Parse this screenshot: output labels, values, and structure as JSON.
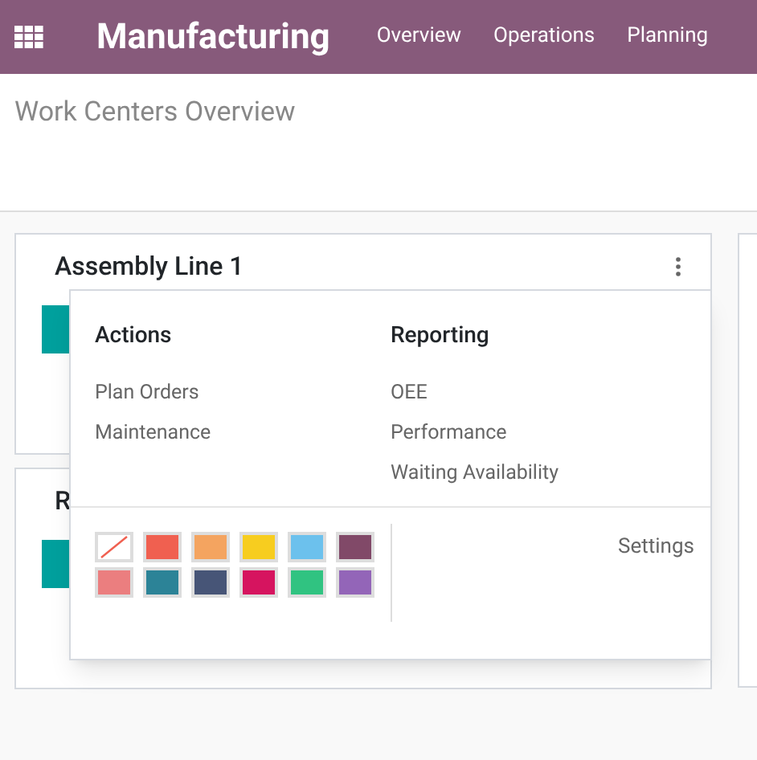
{
  "navbar": {
    "app_title": "Manufacturing",
    "menu": [
      "Overview",
      "Operations",
      "Planning"
    ]
  },
  "breadcrumb": "Work Centers Overview",
  "cards": [
    {
      "title": "Assembly Line 1"
    },
    {
      "title": "R"
    }
  ],
  "dropdown": {
    "sections": [
      {
        "title": "Actions",
        "items": [
          "Plan Orders",
          "Maintenance"
        ]
      },
      {
        "title": "Reporting",
        "items": [
          "OEE",
          "Performance",
          "Waiting Availability"
        ]
      }
    ],
    "colors": [
      {
        "kind": "none"
      },
      {
        "kind": "color",
        "color": "#f06050"
      },
      {
        "kind": "color",
        "color": "#f4a460"
      },
      {
        "kind": "color",
        "color": "#f7cd1f"
      },
      {
        "kind": "color",
        "color": "#6cc1ed"
      },
      {
        "kind": "color",
        "color": "#814968"
      },
      {
        "kind": "color",
        "color": "#eb7e7f"
      },
      {
        "kind": "color",
        "color": "#2c8397"
      },
      {
        "kind": "color",
        "color": "#475577"
      },
      {
        "kind": "color",
        "color": "#d6145f"
      },
      {
        "kind": "color",
        "color": "#30c381"
      },
      {
        "kind": "color",
        "color": "#9365b8"
      }
    ],
    "settings": "Settings"
  }
}
